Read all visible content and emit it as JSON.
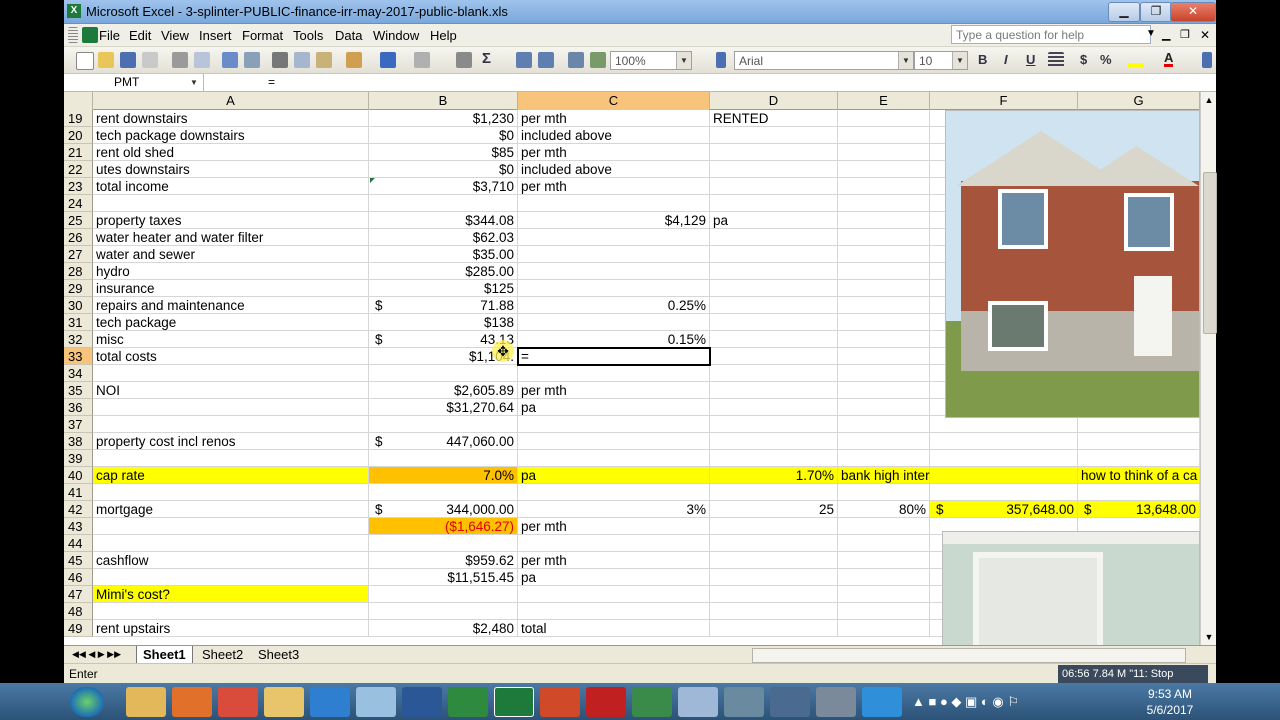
{
  "window": {
    "title": "Microsoft Excel - 3-splinter-PUBLIC-finance-irr-may-2017-public-blank.xls",
    "app_icon": "X"
  },
  "menu": [
    "File",
    "Edit",
    "View",
    "Insert",
    "Format",
    "Tools",
    "Data",
    "Window",
    "Help"
  ],
  "help_placeholder": "Type a question for help",
  "toolbar": {
    "zoom": "100%",
    "font": "Arial",
    "font_size": "10"
  },
  "formula_bar": {
    "name_box": "PMT",
    "formula": "="
  },
  "columns": [
    "A",
    "B",
    "C",
    "D",
    "E",
    "F",
    "G"
  ],
  "rows": [
    {
      "n": "19",
      "A": "rent downstairs",
      "B": "$1,230",
      "C": "per mth",
      "D": "RENTED"
    },
    {
      "n": "20",
      "A": "tech package downstairs",
      "B": "$0",
      "C": "included above"
    },
    {
      "n": "21",
      "A": "rent old shed",
      "B": "$85",
      "C": "per mth"
    },
    {
      "n": "22",
      "A": "utes downstairs",
      "B": "$0",
      "C": "included above"
    },
    {
      "n": "23",
      "A": "total income",
      "B": "$3,710",
      "C": "per mth"
    },
    {
      "n": "24"
    },
    {
      "n": "25",
      "A": "property taxes",
      "B": "$344.08",
      "C": "$4,129",
      "D": "pa"
    },
    {
      "n": "26",
      "A": "water heater and water filter",
      "B": "$62.03"
    },
    {
      "n": "27",
      "A": "water and sewer",
      "B": "$35.00"
    },
    {
      "n": "28",
      "A": "hydro",
      "B": "$285.00"
    },
    {
      "n": "29",
      "A": "insurance",
      "B": "$125"
    },
    {
      "n": "30",
      "A": "repairs and maintenance",
      "Bc": "$",
      "B": "71.88",
      "C": "0.25%"
    },
    {
      "n": "31",
      "A": "tech package",
      "B": "$138"
    },
    {
      "n": "32",
      "A": "misc",
      "Bc": "$",
      "B": "43.13",
      "C": "0.15%"
    },
    {
      "n": "33",
      "A": "total costs",
      "B": "$1,104.",
      "C": "="
    },
    {
      "n": "34"
    },
    {
      "n": "35",
      "A": "NOI",
      "B": "$2,605.89",
      "C": "per mth"
    },
    {
      "n": "36",
      "B": "$31,270.64",
      "C": "pa"
    },
    {
      "n": "37"
    },
    {
      "n": "38",
      "A": "property cost incl renos",
      "Bc": "$",
      "B": "447,060.00"
    },
    {
      "n": "39"
    },
    {
      "n": "40",
      "A": "cap rate",
      "B": "7.0%",
      "C": "pa",
      "D": "1.70%",
      "E": "bank high interest savings acct",
      "G": "how to think of a ca"
    },
    {
      "n": "41"
    },
    {
      "n": "42",
      "A": "mortgage",
      "Bc": "$",
      "B": "344,000.00",
      "C": "3%",
      "D": "25",
      "E": "80%",
      "Fc": "$",
      "F": "357,648.00",
      "Gc": "$",
      "G": "13,648.00"
    },
    {
      "n": "43",
      "B": "($1,646.27)",
      "C": "per mth"
    },
    {
      "n": "44"
    },
    {
      "n": "45",
      "A": "cashflow",
      "B": "$959.62",
      "C": "per mth"
    },
    {
      "n": "46",
      "B": "$11,515.45",
      "C": "pa"
    },
    {
      "n": "47",
      "A": "Mimi's cost?"
    },
    {
      "n": "48"
    },
    {
      "n": "49",
      "A": "rent upstairs",
      "B": "$2,480",
      "C": "total"
    }
  ],
  "sheets": [
    "Sheet1",
    "Sheet2",
    "Sheet3"
  ],
  "status": {
    "mode": "Enter",
    "recorder": "06:56  7.84 M  \"11: Stop"
  },
  "clock": {
    "time": "9:53 AM",
    "date": "5/6/2017"
  }
}
